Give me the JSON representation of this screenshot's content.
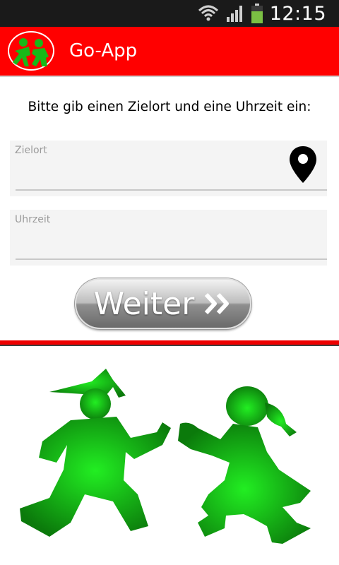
{
  "status_bar": {
    "time": "12:15",
    "icons": [
      "wifi-icon",
      "signal-icon",
      "battery-icon"
    ]
  },
  "app_bar": {
    "title": "Go-App",
    "logo": "ampelmann-logo-icon",
    "background": "#ff0000"
  },
  "form": {
    "instruction": "Bitte gib einen Zielort und eine Uhrzeit ein:",
    "destination": {
      "label": "Zielort",
      "value": "",
      "icon": "map-pin-icon"
    },
    "time": {
      "label": "Uhrzeit",
      "value": ""
    },
    "submit_label": "Weiter",
    "submit_icon": "double-chevron-icon"
  },
  "illustration": {
    "subject": "green-ampelmann-pedestrians",
    "colors": {
      "figure": "#22cc22",
      "accent": "#ee0000"
    }
  }
}
